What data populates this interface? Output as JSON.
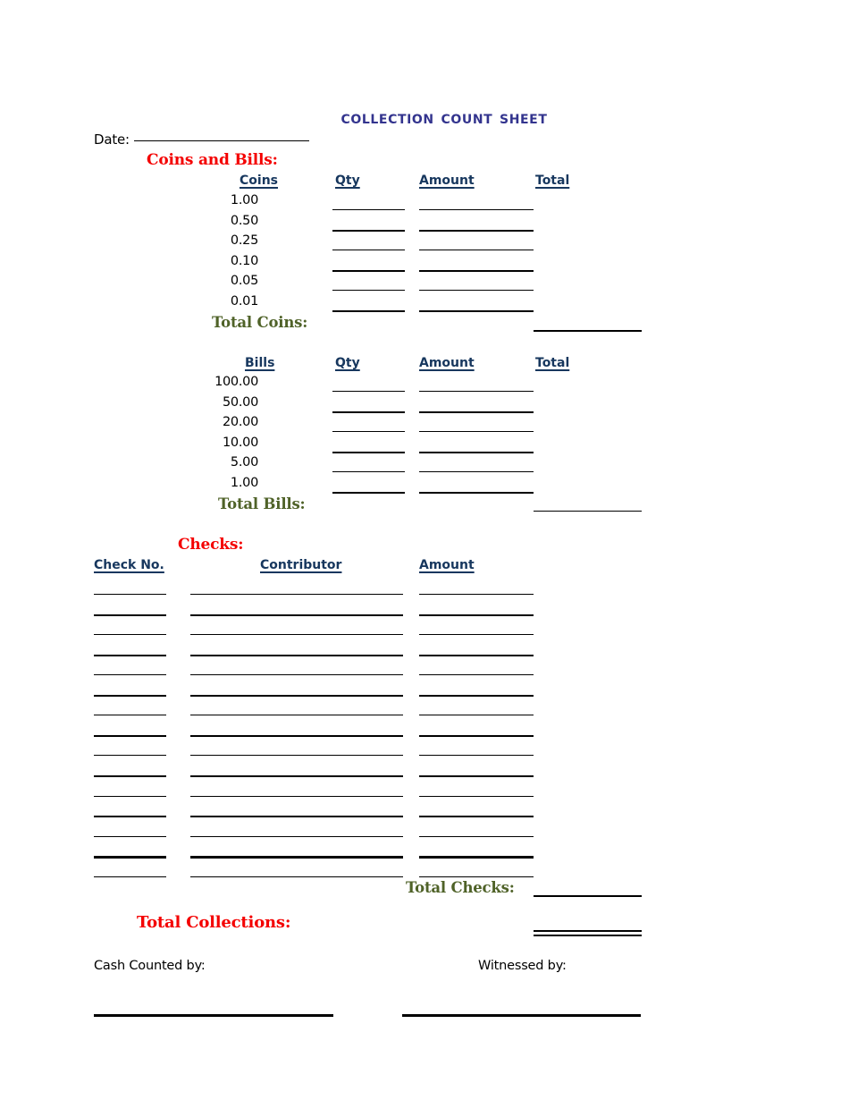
{
  "document": {
    "title": "Collection Count Sheet",
    "date_label": "Date:",
    "date_value": ""
  },
  "coins_and_bills": {
    "heading": "Coins and Bills:",
    "columns": {
      "denomination": "Coins",
      "qty": "Qty",
      "amount": "Amount",
      "total": "Total "
    },
    "coin_denominations": [
      "1.00",
      "0.50",
      "0.25",
      "0.10",
      "0.05",
      "0.01"
    ],
    "total_coins_label": "Total Coins:",
    "total_coins_value": ""
  },
  "bills": {
    "columns": {
      "denomination": "Bills",
      "qty": "Qty",
      "amount": "Amount",
      "total": "Total "
    },
    "bill_denominations": [
      "100.00",
      "50.00",
      "20.00",
      "10.00",
      "5.00",
      "1.00"
    ],
    "total_bills_label": "Total Bills:",
    "total_bills_value": ""
  },
  "checks": {
    "heading": "Checks:",
    "columns": {
      "check_no": "Check No.",
      "contributor": "Contributor",
      "amount": "Amount"
    },
    "row_count": 15,
    "total_checks_label": "Total Checks:",
    "total_checks_value": ""
  },
  "totals": {
    "total_collections_label": "Total Collections:",
    "total_collections_value": ""
  },
  "footer": {
    "cash_counted_by_label": "Cash Counted by:",
    "cash_counted_by_value": "",
    "witnessed_by_label": "Witnessed by:",
    "witnessed_by_value": ""
  },
  "colors": {
    "title_blue": "#33348e",
    "heading_red": "#f40000",
    "total_olive": "#4f6228",
    "column_header_navy": "#17375e",
    "rule_black": "#000000"
  }
}
